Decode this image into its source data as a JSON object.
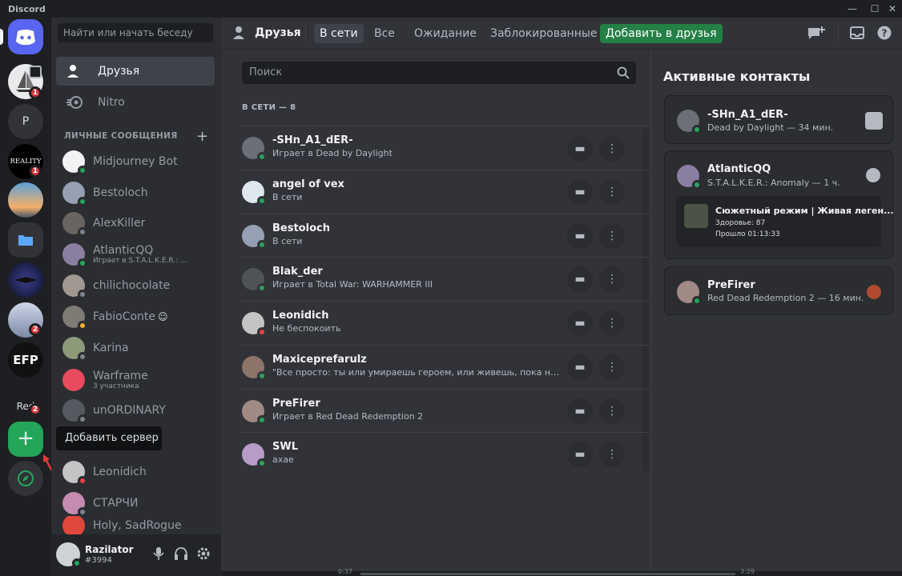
{
  "window": {
    "title": "Discord"
  },
  "colors": {
    "accent": "#5865f2",
    "online": "#23a55a",
    "dnd": "#f23f43",
    "add_friend": "#248046",
    "badge": "#da373c"
  },
  "servers": [
    {
      "name": "discord-home",
      "badge": ""
    },
    {
      "name": "sailboat-server",
      "badge": "1"
    },
    {
      "name": "P",
      "badge": ""
    },
    {
      "name": "REALITY",
      "badge": "1"
    },
    {
      "name": "sunset",
      "badge": ""
    },
    {
      "name": "folder",
      "badge": ""
    },
    {
      "name": "dark-bird",
      "badge": ""
    },
    {
      "name": "anime",
      "badge": "2"
    },
    {
      "name": "EFP",
      "badge": ""
    },
    {
      "name": "Red",
      "badge": "2"
    }
  ],
  "server_badges": {
    "sail": "1",
    "reality": "1",
    "anime": "2",
    "red": "2"
  },
  "server_labels": {
    "p": "P",
    "reality": "REALITY",
    "efp": "EFP",
    "red": "Red"
  },
  "tooltip": {
    "add_server": "Добавить сервер"
  },
  "sidebar": {
    "search_placeholder": "Найти или начать беседу",
    "friends_label": "Друзья",
    "nitro_label": "Nitro",
    "dm_header": "ЛИЧНЫЕ СООБЩЕНИЯ",
    "dms": [
      {
        "name": "Midjourney Bot",
        "sub": "",
        "status": "online"
      },
      {
        "name": "Bestoloch",
        "sub": "",
        "status": "online"
      },
      {
        "name": "AlexKiller",
        "sub": "",
        "status": "offline"
      },
      {
        "name": "AtlanticQQ",
        "sub": "Играет в S.T.A.L.K.E.R.: ...",
        "status": "online"
      },
      {
        "name": "chilichocolate",
        "sub": "",
        "status": "offline"
      },
      {
        "name": "FabioConte",
        "sub": "",
        "status": "idle"
      },
      {
        "name": "Karina",
        "sub": "",
        "status": "offline"
      },
      {
        "name": "Warframe",
        "sub": "3 участника",
        "status": ""
      },
      {
        "name": "unORDINARY",
        "sub": "",
        "status": "offline"
      },
      {
        "name": "Leonidich",
        "sub": "",
        "status": "dnd"
      },
      {
        "name": "СТАРЧИ",
        "sub": "",
        "status": "offline"
      },
      {
        "name": "Holy, SadRogue",
        "sub": "",
        "status": ""
      }
    ]
  },
  "user": {
    "name": "Razilator",
    "tag": "#3994"
  },
  "header": {
    "title": "Друзья",
    "tabs": [
      "В сети",
      "Все",
      "Ожидание",
      "Заблокированные"
    ],
    "add_friend": "Добавить в друзья"
  },
  "main": {
    "search_placeholder": "Поиск",
    "online_header": "В СЕТИ — 8",
    "friends": [
      {
        "name": "-SHn_A1_dER-",
        "status_text": "Играет в Dead by Daylight",
        "status": "online"
      },
      {
        "name": "angel of vex",
        "status_text": "В сети",
        "status": "online"
      },
      {
        "name": "Bestoloch",
        "status_text": "В сети",
        "status": "online"
      },
      {
        "name": "Blak_der",
        "status_text": "Играет в Total War: WARHAMMER III",
        "status": "online"
      },
      {
        "name": "Leonidich",
        "status_text": "Не беспокоить",
        "status": "dnd"
      },
      {
        "name": "Maxiceprefarulz",
        "status_text": "\"Все просто: ты или умираешь героем, или живешь, пока не ст...",
        "status": "online"
      },
      {
        "name": "PreFirer",
        "status_text": "Играет в Red Dead Redemption 2",
        "status": "online"
      },
      {
        "name": "SWL",
        "status_text": "axae",
        "status": "online"
      }
    ]
  },
  "active": {
    "title": "Активные контакты",
    "cards": [
      {
        "name": "-SHn_A1_dER-",
        "activity": "Dead by Daylight — 34 мин."
      },
      {
        "name": "AtlanticQQ",
        "activity": "S.T.A.L.K.E.R.: Anomaly — 1 ч.",
        "detail_title": "Сюжетный режим | Живая леген...",
        "detail_line1": "Здоровье: 87",
        "detail_line2": "Прошло 01:13:33"
      },
      {
        "name": "PreFirer",
        "activity": "Red Dead Redemption 2 — 16 мин."
      }
    ]
  },
  "timeline": {
    "left": "0:37",
    "right": "3:29"
  }
}
